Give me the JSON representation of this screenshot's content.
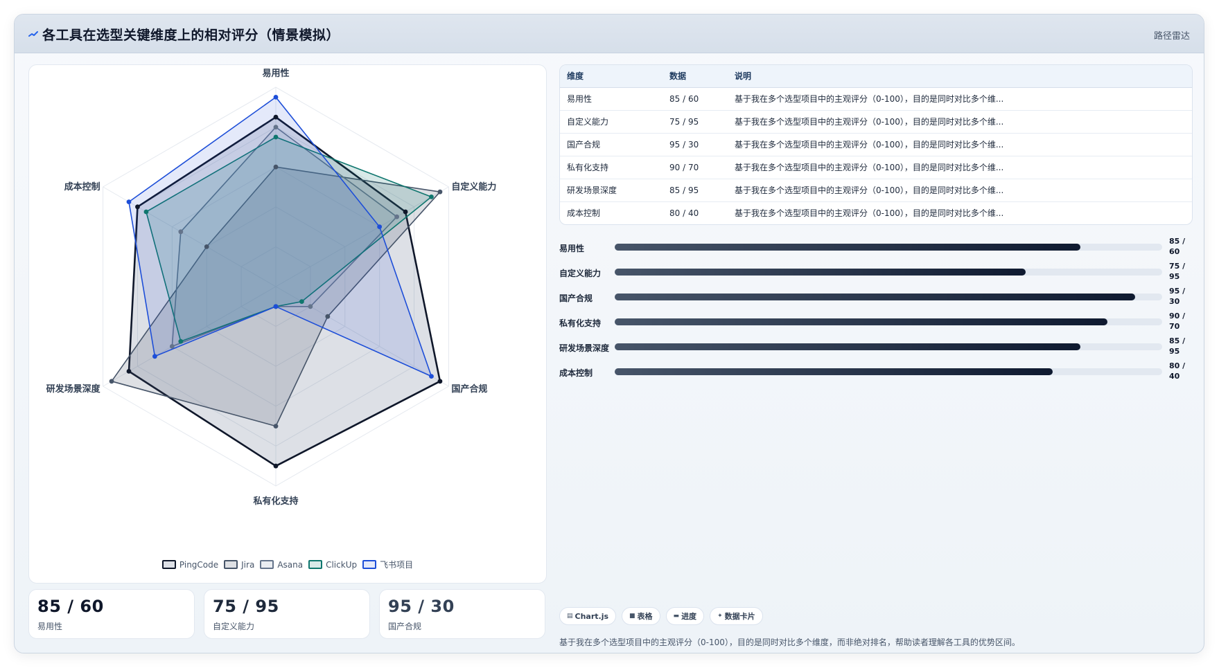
{
  "header": {
    "title": "各工具在选型关键维度上的相对评分（情景模拟）",
    "tag": "路径雷达"
  },
  "chart_data": {
    "type": "radar",
    "axes": [
      "易用性",
      "自定义能力",
      "国产合规",
      "私有化支持",
      "研发场景深度",
      "成本控制"
    ],
    "range": [
      0,
      100
    ],
    "grid": true,
    "legend_position": "bottom",
    "series": [
      {
        "name": "PingCode",
        "values": [
          85,
          75,
          95,
          90,
          85,
          80
        ],
        "color": "#0f172a",
        "fill": "rgba(100,116,139,0.22)"
      },
      {
        "name": "Jira",
        "values": [
          60,
          95,
          30,
          70,
          95,
          40
        ],
        "color": "#475569",
        "fill": "rgba(71,85,105,0.18)"
      },
      {
        "name": "Asana",
        "values": [
          80,
          70,
          20,
          10,
          60,
          55
        ],
        "color": "#64748b",
        "fill": "rgba(148,163,184,0.20)"
      },
      {
        "name": "ClickUp",
        "values": [
          75,
          90,
          15,
          10,
          55,
          75
        ],
        "color": "#0f766e",
        "fill": "rgba(15,118,110,0.16)"
      },
      {
        "name": "飞书项目",
        "values": [
          95,
          60,
          90,
          10,
          70,
          85
        ],
        "color": "#1d4ed8",
        "fill": "rgba(29,78,216,0.12)"
      }
    ]
  },
  "table": {
    "headers": [
      "维度",
      "数据",
      "说明"
    ],
    "rows": [
      {
        "dim": "易用性",
        "data": "85 / 60",
        "note": "基于我在多个选型项目中的主观评分（0-100），目的是同时对比多个维..."
      },
      {
        "dim": "自定义能力",
        "data": "75 / 95",
        "note": "基于我在多个选型项目中的主观评分（0-100），目的是同时对比多个维..."
      },
      {
        "dim": "国产合规",
        "data": "95 / 30",
        "note": "基于我在多个选型项目中的主观评分（0-100），目的是同时对比多个维..."
      },
      {
        "dim": "私有化支持",
        "data": "90 / 70",
        "note": "基于我在多个选型项目中的主观评分（0-100），目的是同时对比多个维..."
      },
      {
        "dim": "研发场景深度",
        "data": "85 / 95",
        "note": "基于我在多个选型项目中的主观评分（0-100），目的是同时对比多个维..."
      },
      {
        "dim": "成本控制",
        "data": "80 / 40",
        "note": "基于我在多个选型项目中的主观评分（0-100），目的是同时对比多个维..."
      }
    ]
  },
  "bars": [
    {
      "label": "易用性",
      "value": 85,
      "text": "85 / 60"
    },
    {
      "label": "自定义能力",
      "value": 75,
      "text": "75 / 95"
    },
    {
      "label": "国产合规",
      "value": 95,
      "text": "95 / 30"
    },
    {
      "label": "私有化支持",
      "value": 90,
      "text": "90 / 70"
    },
    {
      "label": "研发场景深度",
      "value": 85,
      "text": "85 / 95"
    },
    {
      "label": "成本控制",
      "value": 80,
      "text": "80 / 40"
    }
  ],
  "kpis": [
    {
      "value": "85 / 60",
      "label": "易用性",
      "color": "#0f172a"
    },
    {
      "value": "75 / 95",
      "label": "自定义能力",
      "color": "#1e293b"
    },
    {
      "value": "95 / 30",
      "label": "国产合规",
      "color": "#334155"
    }
  ],
  "chips": [
    {
      "icon": "▤",
      "icon_name": "chart-icon",
      "label": "Chart.js"
    },
    {
      "icon": "■",
      "icon_name": "table-icon",
      "label": "表格"
    },
    {
      "icon": "▬",
      "icon_name": "progress-icon",
      "label": "进度"
    },
    {
      "icon": "✦",
      "icon_name": "card-icon",
      "label": "数据卡片"
    }
  ],
  "description": "基于我在多个选型项目中的主观评分（0-100），目的是同时对比多个维度，而非绝对排名，帮助读者理解各工具的优势区间。"
}
